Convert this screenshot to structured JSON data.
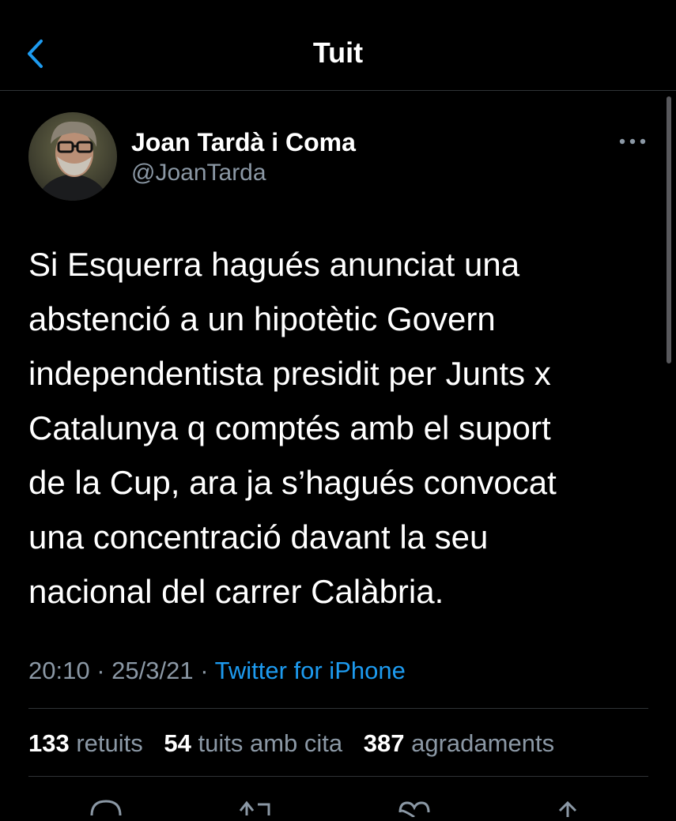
{
  "header": {
    "title": "Tuit",
    "back_icon": "chevron-left-icon",
    "accent": "#1d9bf0"
  },
  "author": {
    "name": "Joan Tardà i Coma",
    "handle": "@JoanTarda"
  },
  "tweet": {
    "text": "Si Esquerra hagués anunciat una\nabstenció a un hipotètic Govern\nindependentista presidit per Junts x\nCatalunya q comptés amb el suport\nde la Cup, ara ja s’hagués convocat\nuna concentració davant la seu\nnacional del carrer Calàbria.",
    "time": "20:10",
    "date": "25/3/21",
    "separator": "·",
    "source": "Twitter for iPhone"
  },
  "stats": {
    "retweets": {
      "count": "133",
      "label": "retuits"
    },
    "quotes": {
      "count": "54",
      "label": "tuits amb cita"
    },
    "likes": {
      "count": "387",
      "label": "agradaments"
    }
  },
  "actions": [
    "reply-icon",
    "retweet-icon",
    "like-icon",
    "share-icon"
  ]
}
